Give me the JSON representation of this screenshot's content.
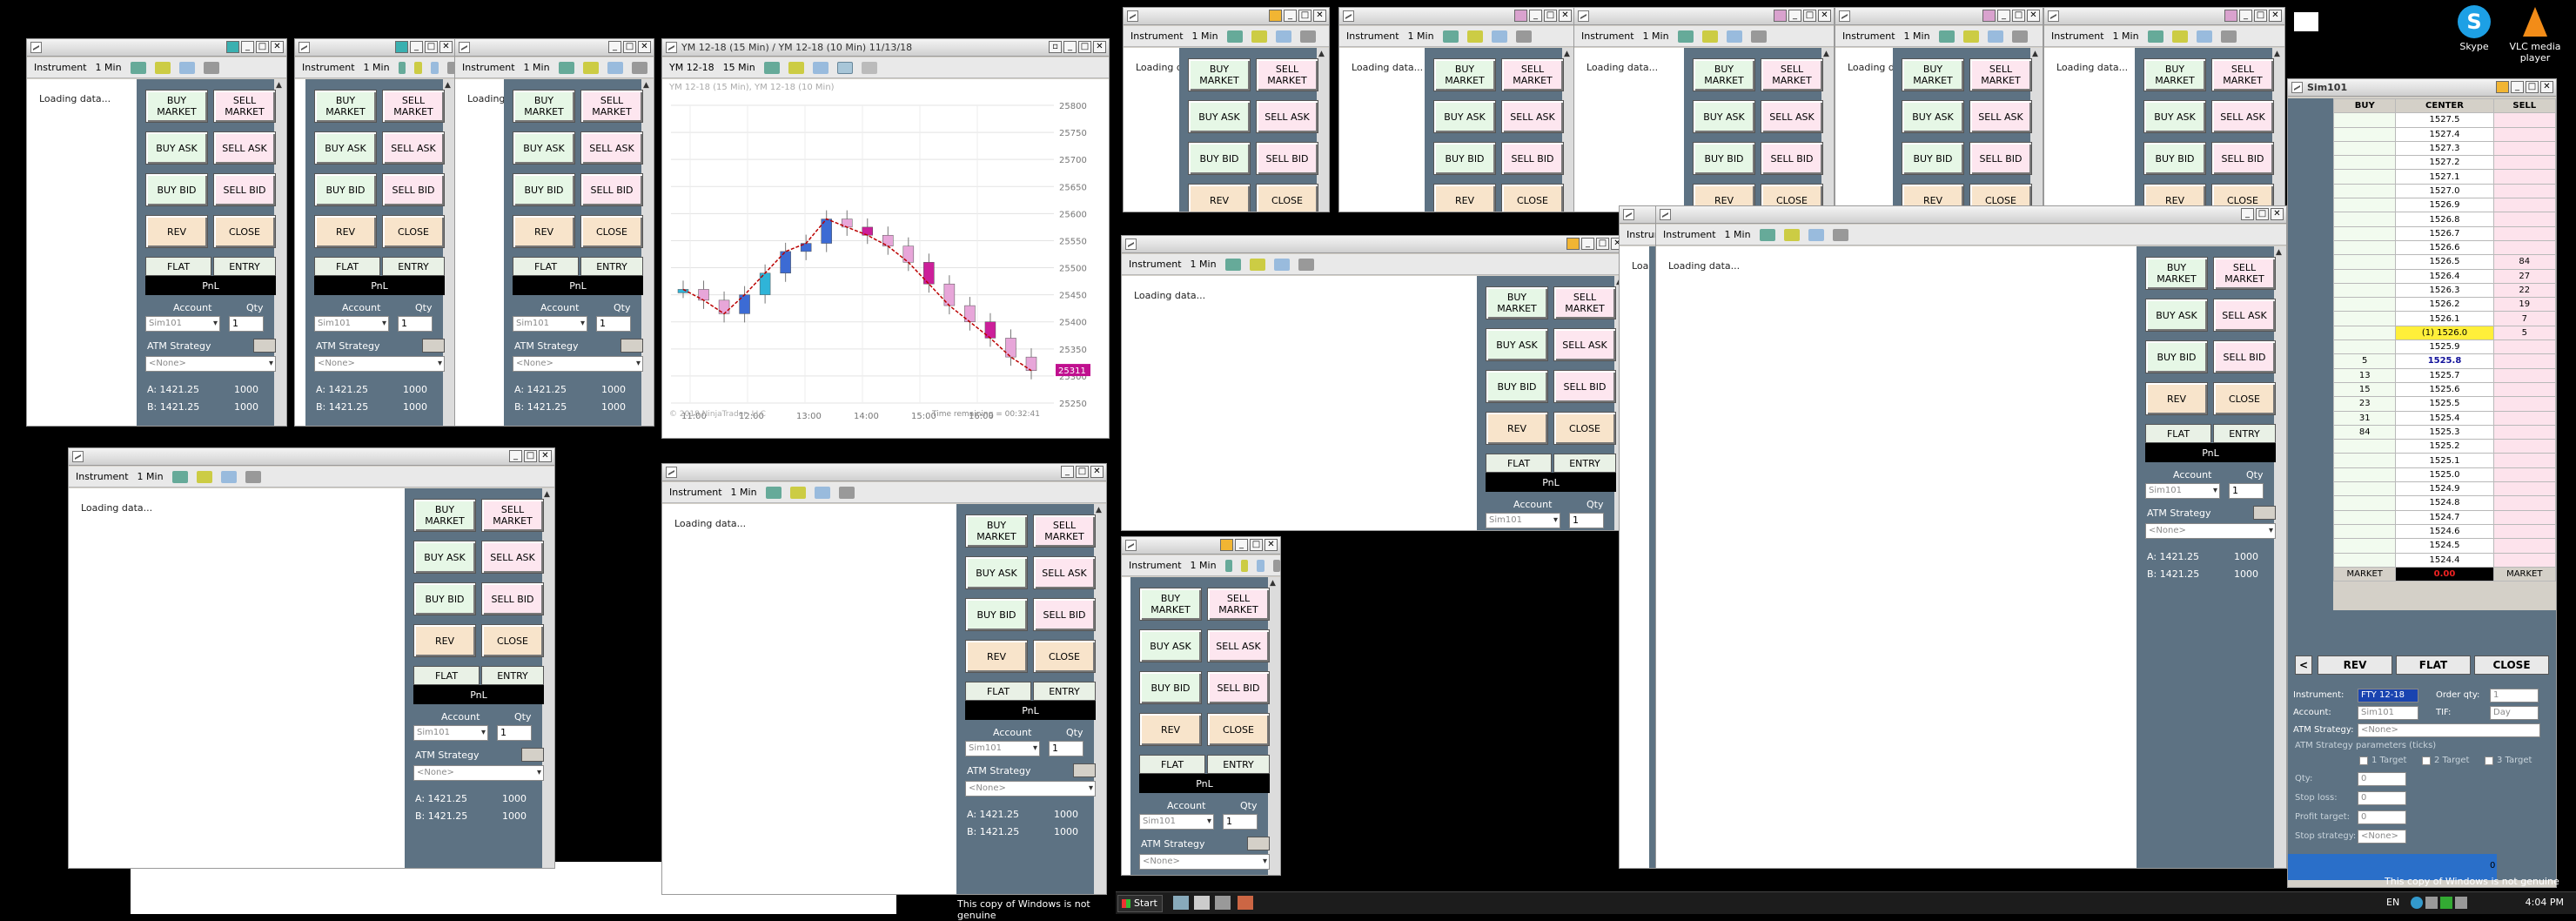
{
  "common": {
    "instrument": "Instrument",
    "interval": "1 Min",
    "loading": "Loading data...",
    "buy_market": "BUY\nMARKET",
    "sell_market": "SELL\nMARKET",
    "buy_ask": "BUY ASK",
    "sell_ask": "SELL ASK",
    "buy_bid": "BUY BID",
    "sell_bid": "SELL BID",
    "rev": "REV",
    "close": "CLOSE",
    "flat": "FLAT",
    "entry": "ENTRY",
    "pnl": "PnL",
    "account_label": "Account",
    "qty_label": "Qty",
    "account_value": "Sim101",
    "qty_value": "1",
    "atm_label": "ATM Strategy",
    "atm_value": "<None>",
    "ask_text": "A: 1421.25",
    "bid_text": "B: 1421.25",
    "ask_size": "1000",
    "bid_size": "1000"
  },
  "chart": {
    "title": "YM 12-18 (15 Min) / YM 12-18 (10 Min)  11/13/18",
    "instrument": "YM 12-18",
    "interval": "15 Min",
    "caption": "YM 12-18 (15 Min), YM 12-18 (10 Min)",
    "copyright": "© 2018 NinjaTrader, LLC",
    "time_remaining": "Time remaining = 00:32:41",
    "last_price_tag": "25311",
    "x_labels": [
      "11:00",
      "12:00",
      "13:00",
      "14:00",
      "15:00",
      "16:00"
    ],
    "y_labels": [
      "25800",
      "25750",
      "25700",
      "25650",
      "25600",
      "25550",
      "25500",
      "25450",
      "25400",
      "25350",
      "25300",
      "25250"
    ]
  },
  "chart_data": {
    "type": "candlestick",
    "title": "YM 12-18 (15 Min) / YM 12-18 (10 Min)  11/13/18",
    "x": [
      "11:00",
      "12:00",
      "13:00",
      "14:00",
      "15:00",
      "16:00"
    ],
    "ylim": [
      25250,
      25800
    ],
    "y_ticks": [
      25800,
      25750,
      25700,
      25650,
      25600,
      25550,
      25500,
      25450,
      25400,
      25350,
      25300,
      25250
    ],
    "approx_close_path": [
      25460,
      25440,
      25415,
      25450,
      25490,
      25530,
      25545,
      25590,
      25575,
      25560,
      25540,
      25510,
      25470,
      25430,
      25400,
      25370,
      25335,
      25310
    ]
  },
  "dom": {
    "title": "Sim101",
    "headers": [
      "BUY",
      "CENTER",
      "SELL"
    ],
    "prices": [
      "1527.5",
      "1527.4",
      "1527.3",
      "1527.2",
      "1527.1",
      "1527.0",
      "1526.9",
      "1526.8",
      "1526.7",
      "1526.6",
      "1526.5",
      "1526.4",
      "1526.3",
      "1526.2",
      "1526.1",
      "(1) 1526.0",
      "1525.9",
      "1525.8",
      "1525.7",
      "1525.6",
      "1525.5",
      "1525.4",
      "1525.3",
      "1525.2",
      "1525.1",
      "1525.0",
      "1524.9",
      "1524.8",
      "1524.7",
      "1524.6",
      "1524.5",
      "1524.4"
    ],
    "buy": [
      "",
      "",
      "",
      "",
      "",
      "",
      "",
      "",
      "",
      "",
      "",
      "",
      "",
      "",
      "",
      "",
      "",
      "5",
      "13",
      "15",
      "23",
      "31",
      "84",
      "",
      "",
      "",
      "",
      "",
      "",
      "",
      "",
      ""
    ],
    "sell": [
      "",
      "",
      "",
      "",
      "",
      "",
      "",
      "",
      "",
      "",
      "84",
      "27",
      "22",
      "19",
      "7",
      "5",
      "",
      "",
      "",
      "",
      "",
      "",
      "",
      "",
      "",
      "",
      "",
      "",
      "",
      "",
      "",
      ""
    ],
    "market_left": "MARKET",
    "market_mid": "0.00",
    "market_right": "MARKET",
    "bottom_btns": [
      "<",
      "REV",
      "FLAT",
      "CLOSE"
    ],
    "instrument_label": "Instrument:",
    "instrument_value": "FTY 12-18",
    "orderqty_label": "Order qty:",
    "orderqty_value": "1",
    "account_label": "Account:",
    "account_value": "Sim101",
    "tif_label": "TIF:",
    "tif_value": "Day",
    "atm_label": "ATM Strategy:",
    "atm_value": "<None>",
    "params_label": "ATM Strategy parameters (ticks)",
    "targets": [
      "1 Target",
      "2 Target",
      "3 Target"
    ],
    "param_rows": [
      "Qty:",
      "Stop loss:",
      "Profit target:",
      "Stop strategy:"
    ],
    "param_vals": [
      "0",
      "0",
      "0",
      "<None>"
    ],
    "zero": "0"
  },
  "desktop": {
    "skype": "Skype",
    "vlc": "VLC media player"
  },
  "taskbar": {
    "start": "Start",
    "watermark": "This copy of Windows is not genuine",
    "lang": "EN",
    "clock": "4:04 PM"
  }
}
